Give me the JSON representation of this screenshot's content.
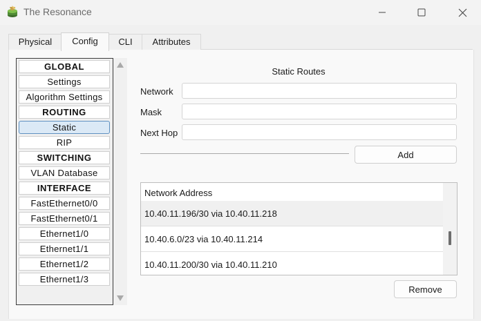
{
  "window": {
    "title": "The Resonance",
    "controls": {
      "minimize_icon": "minimize-icon",
      "maximize_icon": "maximize-icon",
      "close_icon": "close-icon"
    }
  },
  "tabs": [
    {
      "label": "Physical",
      "active": false
    },
    {
      "label": "Config",
      "active": true
    },
    {
      "label": "CLI",
      "active": false
    },
    {
      "label": "Attributes",
      "active": false
    }
  ],
  "sidebar": {
    "items": [
      {
        "label": "GLOBAL",
        "type": "header"
      },
      {
        "label": "Settings",
        "type": "item"
      },
      {
        "label": "Algorithm Settings",
        "type": "item"
      },
      {
        "label": "ROUTING",
        "type": "header"
      },
      {
        "label": "Static",
        "type": "item",
        "selected": true
      },
      {
        "label": "RIP",
        "type": "item"
      },
      {
        "label": "SWITCHING",
        "type": "header"
      },
      {
        "label": "VLAN Database",
        "type": "item"
      },
      {
        "label": "INTERFACE",
        "type": "header"
      },
      {
        "label": "FastEthernet0/0",
        "type": "item"
      },
      {
        "label": "FastEthernet0/1",
        "type": "item"
      },
      {
        "label": "Ethernet1/0",
        "type": "item"
      },
      {
        "label": "Ethernet1/1",
        "type": "item"
      },
      {
        "label": "Ethernet1/2",
        "type": "item"
      },
      {
        "label": "Ethernet1/3",
        "type": "item"
      }
    ]
  },
  "static_routes": {
    "title": "Static Routes",
    "network_label": "Network",
    "network_value": "",
    "mask_label": "Mask",
    "mask_value": "",
    "next_hop_label": "Next Hop",
    "next_hop_value": "",
    "add_label": "Add",
    "list_header": "Network Address",
    "routes": [
      "10.40.11.196/30 via 10.40.11.218",
      "10.40.6.0/23 via 10.40.11.214",
      "10.40.11.200/30 via 10.40.11.210"
    ],
    "selected_route_index": 0,
    "remove_label": "Remove"
  },
  "colors": {
    "selected_item_bg": "#dbe9f6",
    "selected_item_border": "#5d8fc0",
    "window_bg": "#f0f0f0"
  }
}
